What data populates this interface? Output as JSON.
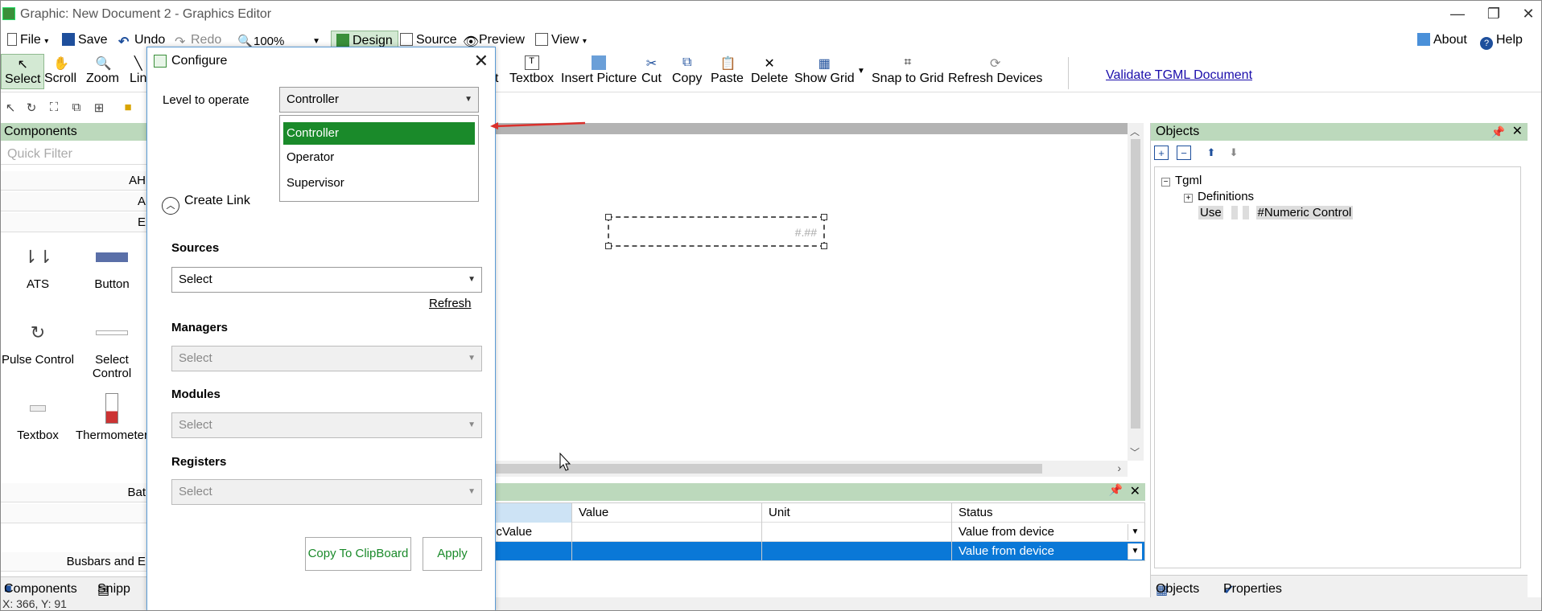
{
  "window": {
    "title": "Graphic: New Document 2 - Graphics Editor",
    "controls": {
      "minimize": "—",
      "restore": "❐",
      "close": "✕"
    }
  },
  "menubar": {
    "file": "File",
    "save": "Save",
    "undo": "Undo",
    "redo": "Redo",
    "zoom": "100%",
    "design": "Design",
    "source": "Source",
    "preview": "Preview",
    "view": "View",
    "about": "About",
    "help": "Help"
  },
  "ribbon": {
    "select": "Select",
    "scroll": "Scroll",
    "zoom": "Zoom",
    "line": "Lin",
    "text_tail": "t",
    "textbox": "Textbox",
    "insert_picture": "Insert Picture",
    "cut": "Cut",
    "copy": "Copy",
    "paste": "Paste",
    "delete": "Delete",
    "show_grid": "Show Grid",
    "snap_to_grid": "Snap to Grid",
    "refresh_devices": "Refresh Devices",
    "validate": "Validate TGML Document"
  },
  "left_panel": {
    "header": "Components",
    "quick_filter_placeholder": "Quick Filter",
    "categories": [
      "AH",
      "A",
      "E",
      "Bat",
      "",
      "Busbars and E"
    ],
    "items": [
      {
        "label": "ATS",
        "icon": "ats-icon"
      },
      {
        "label": "Button",
        "icon": "button-icon"
      },
      {
        "label": "Pulse Control",
        "icon": "pulse-control-icon"
      },
      {
        "label": "Select Control",
        "icon": "select-control-icon"
      },
      {
        "label": "Textbox",
        "icon": "textbox-icon"
      },
      {
        "label": "Thermometer",
        "icon": "thermometer-icon"
      }
    ],
    "tabs": {
      "components": "Components",
      "snippets": "Snipp"
    }
  },
  "statusbar": {
    "coords": "X: 366, Y: 91"
  },
  "canvas": {
    "numeric_placeholder": "#.##"
  },
  "bottom_grid": {
    "columns": [
      "",
      "Value",
      "Unit",
      "Status"
    ],
    "rows": [
      [
        "icValue",
        "",
        "",
        "Value from device"
      ],
      [
        "",
        "",
        "",
        "Value from device"
      ]
    ]
  },
  "right_panel": {
    "header": "Objects",
    "tree": {
      "root": "Tgml",
      "definitions": "Definitions",
      "use": "Use",
      "numeric_control": "#Numeric Control"
    },
    "tabs": {
      "objects": "Objects",
      "properties": "Properties"
    }
  },
  "dialog": {
    "title": "Configure",
    "level_label": "Level to operate",
    "level_value": "Controller",
    "level_options": [
      "Controller",
      "Operator",
      "Supervisor"
    ],
    "create_link": "Create Link",
    "sources_label": "Sources",
    "sources_value": "Select",
    "refresh": "Refresh",
    "managers_label": "Managers",
    "managers_value": "Select",
    "modules_label": "Modules",
    "modules_value": "Select",
    "registers_label": "Registers",
    "registers_value": "Select",
    "copy_button": "Copy To ClipBoard",
    "apply_button": "Apply"
  },
  "colors": {
    "accent_green": "#1a8a2a",
    "panel_header": "#bcd9bc",
    "selection_blue": "#0a78d7",
    "annotation_red": "#d9302c"
  }
}
